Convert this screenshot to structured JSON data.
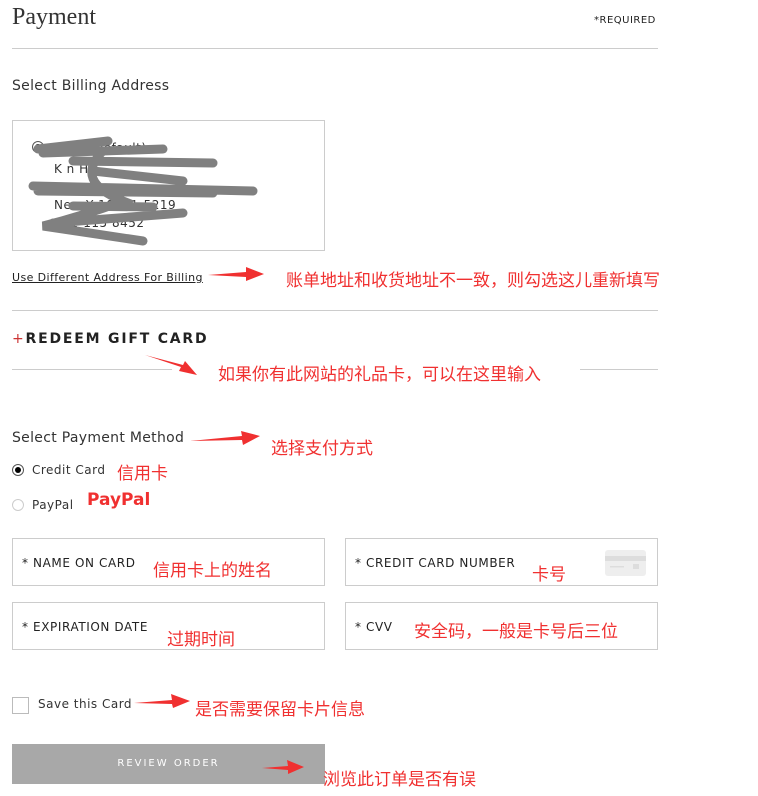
{
  "header": {
    "title": "Payment",
    "required": "*REQUIRED"
  },
  "billing": {
    "heading": "Select Billing Address",
    "name": "N      rk",
    "default": "(Default)",
    "recipient": "K     n Hu",
    "street": "",
    "city": "New Y        10001-5219",
    "phone": "181-115  8452",
    "different_link": "Use Different Address For Billing"
  },
  "gift": {
    "plus": "+",
    "label": "REDEEM GIFT CARD"
  },
  "payment": {
    "heading": "Select Payment Method",
    "options": [
      {
        "label": "Credit Card",
        "selected": true
      },
      {
        "label": "PayPal",
        "selected": false
      }
    ]
  },
  "fields": {
    "name_on_card": "* NAME ON CARD",
    "card_number": "* CREDIT CARD NUMBER",
    "expiration": "* EXPIRATION DATE",
    "cvv": "* CVV"
  },
  "save_card": {
    "label": "Save this Card",
    "checked": false
  },
  "review_button": "REVIEW ORDER",
  "annotations": {
    "billing": "账单地址和收货地址不一致，则勾选这儿重新填写",
    "gift": "如果你有此网站的礼品卡，可以在这里输入",
    "method": "选择支付方式",
    "credit": "信用卡",
    "paypal": "PayPal",
    "name": "信用卡上的姓名",
    "number": "卡号",
    "expiration": "过期时间",
    "cvv": "安全码，一般是卡号后三位",
    "save": "是否需要保留卡片信息",
    "review": "浏览此订单是否有误"
  },
  "colors": {
    "annotation": "#f03030",
    "button": "#a8a8a8"
  }
}
